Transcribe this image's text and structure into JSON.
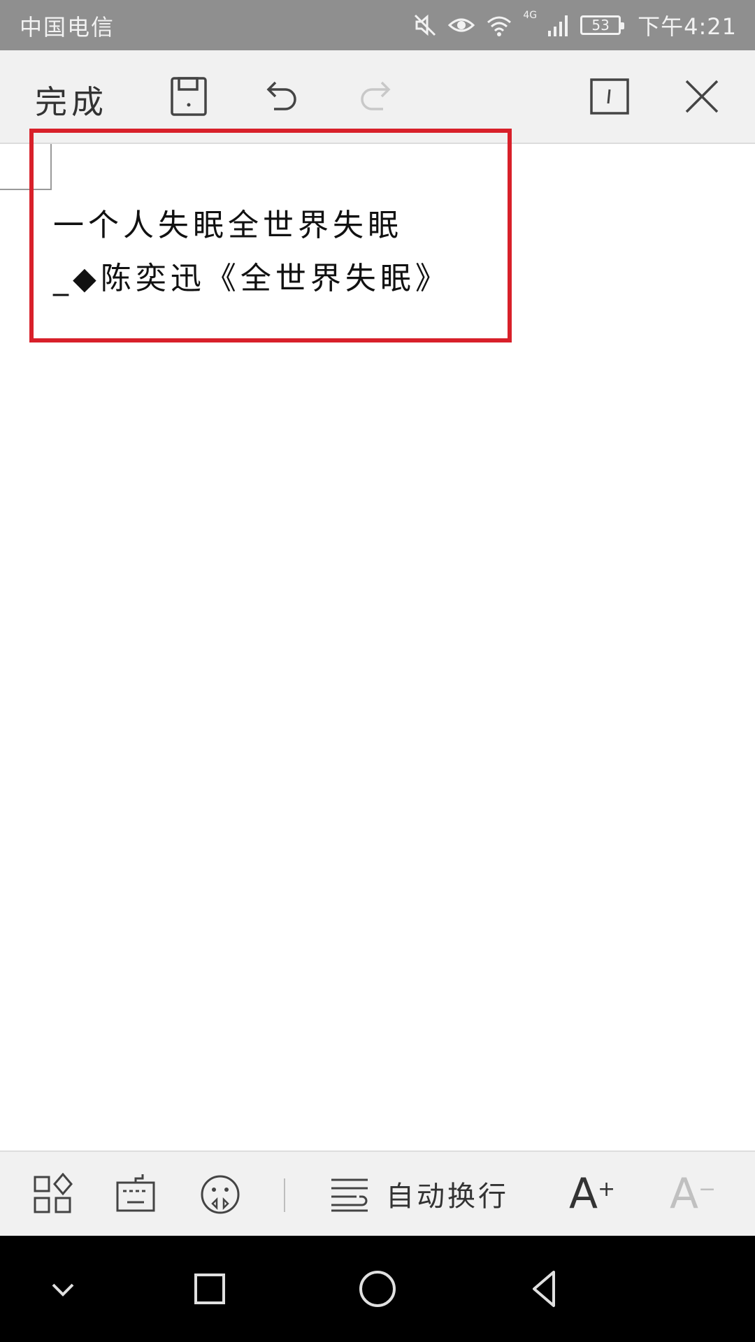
{
  "status_bar": {
    "carrier": "中国电信",
    "network": "4G",
    "battery_level": "53",
    "time": "下午4:21"
  },
  "toolbar": {
    "done_label": "完成",
    "icons": [
      "save-icon",
      "undo-icon",
      "redo-icon",
      "text-cursor-icon",
      "close-icon"
    ]
  },
  "document": {
    "lines": [
      "一个人失眠全世界失眠",
      "_◆陈奕迅《全世界失眠》"
    ],
    "highlight_color": "#d8202a"
  },
  "bottom_bar": {
    "icons": [
      "apps-icon",
      "keyboard-icon",
      "emoji-icon",
      "wrap-lines-icon"
    ],
    "wrap_label": "自动换行",
    "font_increase_label": "A",
    "font_increase_sup": "+",
    "font_decrease_label": "A",
    "font_decrease_sup": "−"
  },
  "nav_bar": {
    "icons": [
      "collapse-icon",
      "recent-apps-icon",
      "home-icon",
      "back-icon"
    ]
  }
}
